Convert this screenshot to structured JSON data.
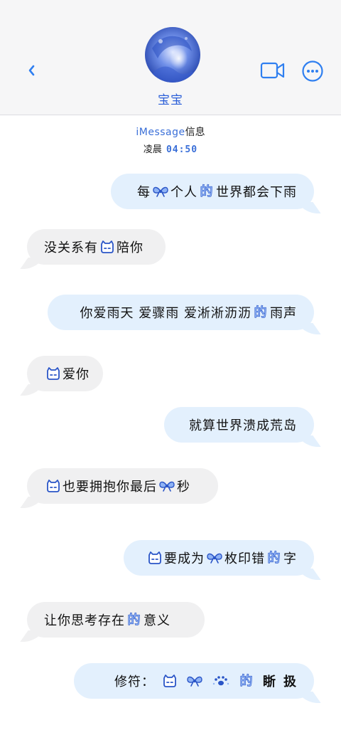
{
  "colors": {
    "accent": "#2b5fd8",
    "outgoing_bubble": "#e3f0fd",
    "incoming_bubble": "#f0f0f1"
  },
  "header": {
    "back_icon": "chevron-left-icon",
    "contact_name": "宝宝",
    "video_icon": "video-camera-icon",
    "more_icon": "ellipsis-circle-icon"
  },
  "meta": {
    "service": "iMessage",
    "service_suffix": "信息",
    "period": "凌晨",
    "time": "04:50"
  },
  "messages": [
    {
      "dir": "out",
      "parts": [
        {
          "t": "每"
        },
        {
          "i": "bow"
        },
        {
          "t": "个人"
        },
        {
          "i": "de"
        },
        {
          "t": "世界都会下雨"
        }
      ]
    },
    {
      "dir": "in",
      "parts": [
        {
          "t": "没关系有"
        },
        {
          "i": "cat"
        },
        {
          "t": "陪你"
        }
      ]
    },
    {
      "dir": "out",
      "parts": [
        {
          "t": "你爱雨天 爱骤雨 爱淅淅沥沥"
        },
        {
          "i": "de"
        },
        {
          "t": "雨声"
        }
      ]
    },
    {
      "dir": "in",
      "parts": [
        {
          "i": "cat"
        },
        {
          "t": "爱你"
        }
      ]
    },
    {
      "dir": "out",
      "parts": [
        {
          "t": "就算世界溃成荒岛"
        }
      ]
    },
    {
      "dir": "in",
      "parts": [
        {
          "i": "cat"
        },
        {
          "t": "也要拥抱你最后"
        },
        {
          "i": "bow"
        },
        {
          "t": "秒"
        }
      ]
    },
    {
      "dir": "out",
      "parts": [
        {
          "i": "cat"
        },
        {
          "t": "要成为"
        },
        {
          "i": "bow"
        },
        {
          "t": "枚印错"
        },
        {
          "i": "de"
        },
        {
          "t": "字"
        }
      ]
    },
    {
      "dir": "in",
      "parts": [
        {
          "t": "让你思考存在"
        },
        {
          "i": "de"
        },
        {
          "t": "意义"
        }
      ]
    },
    {
      "dir": "out",
      "parts": [
        {
          "t": "修符："
        },
        {
          "i": "cat"
        },
        {
          "i": "bow"
        },
        {
          "i": "paw"
        },
        {
          "i": "de"
        },
        {
          "t": "䀿"
        },
        {
          "t": "扱"
        }
      ]
    }
  ]
}
